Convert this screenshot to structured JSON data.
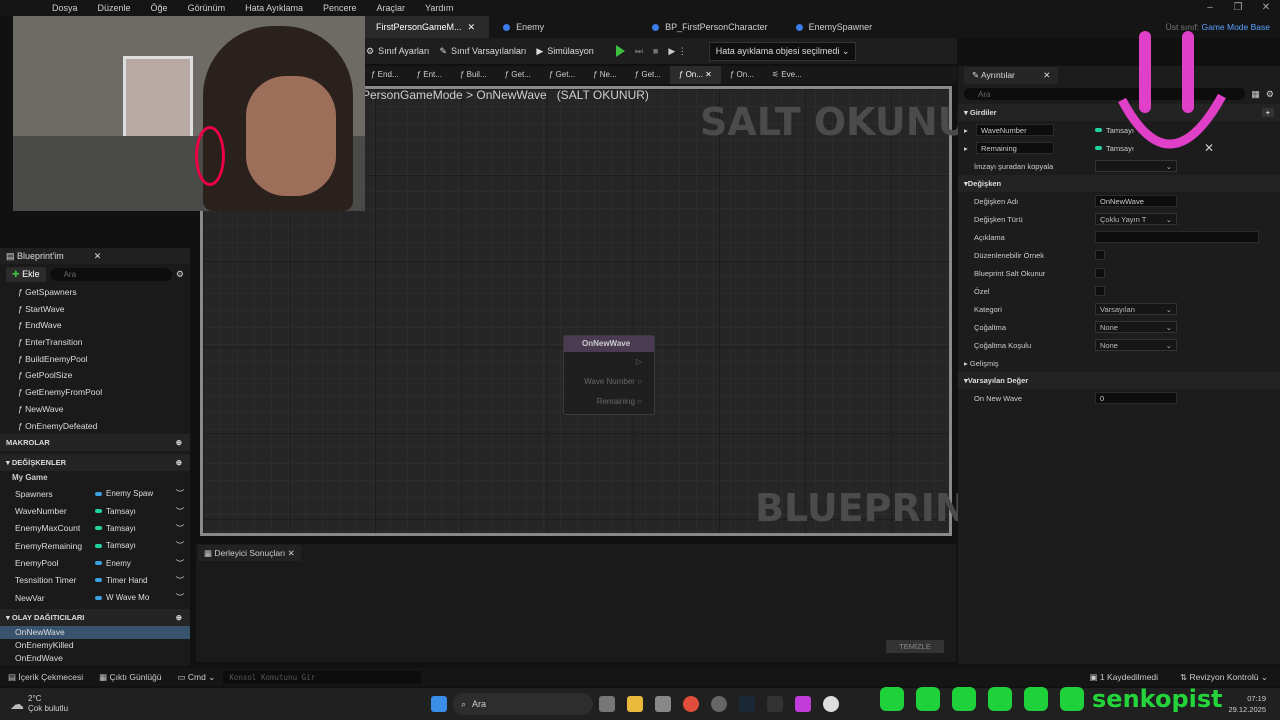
{
  "menu": [
    "Dosya",
    "Düzenle",
    "Öğe",
    "Görünüm",
    "Hata Ayıklama",
    "Pencere",
    "Araçlar",
    "Yardım"
  ],
  "tabs": [
    {
      "label": "FirstPersonGameM...",
      "active": true
    },
    {
      "label": "Enemy"
    },
    {
      "label": "BP_FirstPersonCharacter"
    },
    {
      "label": "EnemySpawner"
    }
  ],
  "parent_class": {
    "label": "Üst sınıf:",
    "value": "Game Mode Base"
  },
  "toolbar": {
    "class_settings": "Sınıf Ayarları",
    "class_defaults": "Sınıf Varsayılanları",
    "simulation": "Simülasyon",
    "debug_object": "Hata ayıklama objesi seçilmedi"
  },
  "fn_tabs": [
    "End...",
    "Ent...",
    "Buil...",
    "Get...",
    "Get...",
    "Ne...",
    "Get...",
    "On...",
    "On...",
    "Eve..."
  ],
  "breadcrumb": {
    "path": "PersonGameMode",
    "sep": ">",
    "func": "OnNewWave",
    "readonly": "(SALT OKUNUR)"
  },
  "graph": {
    "watermark_top": "SALT OKUNUR",
    "watermark_bottom": "BLUEPRINT"
  },
  "node": {
    "title": "OnNewWave",
    "pin1": "Wave Number",
    "pin2": "Remaining"
  },
  "compiler": {
    "tab": "Derleyici Sonuçları",
    "clear": "TEMİZLE"
  },
  "myblueprint": {
    "title": "Blueprint'im",
    "add": "Ekle",
    "search": "Ara",
    "functions": [
      "GetSpawners",
      "StartWave",
      "EndWave",
      "EnterTransition",
      "BuildEnemyPool",
      "GetPoolSize",
      "GetEnemyFromPool",
      "NewWave",
      "OnEnemyDefeated"
    ],
    "macros": "MAKROLAR",
    "variables": "DEĞİŞKENLER",
    "category": "My Game",
    "vars": [
      {
        "name": "Spawners",
        "type": "Enemy Spaw",
        "color": "#3aa0e0"
      },
      {
        "name": "WaveNumber",
        "type": "Tamsayı",
        "color": "#22d3a0"
      },
      {
        "name": "EnemyMaxCount",
        "type": "Tamsayı",
        "color": "#22d3a0"
      },
      {
        "name": "EnemyRemaining",
        "type": "Tamsayı",
        "color": "#22d3a0"
      },
      {
        "name": "EnemyPool",
        "type": "Enemy",
        "color": "#3aa0e0"
      },
      {
        "name": "Tesnsition Timer",
        "type": "Timer Hand",
        "color": "#3aa0e0"
      },
      {
        "name": "NewVar",
        "type": "W Wave Mo",
        "color": "#3aa0e0"
      }
    ],
    "dispatchers": "OLAY DAĞITICILARI",
    "events": [
      "OnNewWave",
      "OnEnemyKilled",
      "OnEndWave"
    ]
  },
  "details": {
    "title": "Ayrıntılar",
    "search": "Ara",
    "inputs_section": "Girdiler",
    "inputs": [
      {
        "name": "WaveNumber",
        "type": "Tamsayı"
      },
      {
        "name": "Remaining",
        "type": "Tamsayı"
      }
    ],
    "copy_sig": "İmzayı şuradan kopyala",
    "var_section": "Değişken",
    "var_name_label": "Değişken Adı",
    "var_name": "OnNewWave",
    "var_type_label": "Değişken Türü",
    "var_type": "Çoklu Yayın T",
    "desc": "Açıklama",
    "editable": "Düzenlenebilir Örnek",
    "bp_readonly": "Blueprint Salt Okunur",
    "private": "Özel",
    "category_label": "Kategori",
    "category": "Varsayılan",
    "repl_label": "Çoğaltma",
    "repl": "None",
    "repl_cond_label": "Çoğaltma Koşulu",
    "repl_cond": "None",
    "advanced": "Gelişmiş",
    "default_section": "Varsayılan Değer",
    "default_label": "On New Wave",
    "default_value": "0"
  },
  "bottombar": {
    "content": "İçerik Çekmecesi",
    "output": "Çıktı Günlüğü",
    "cmd": "Cmd",
    "console": "Konsol Komutunu Gir",
    "saved": "1 Kaydedilmedi",
    "revision": "Revizyon Kontrolü"
  },
  "taskbar": {
    "temp": "2°C",
    "weather": "Çok bulutlu",
    "search": "Ara",
    "time": "07:19",
    "date": "29.12.2025",
    "brand": "senkopist"
  }
}
